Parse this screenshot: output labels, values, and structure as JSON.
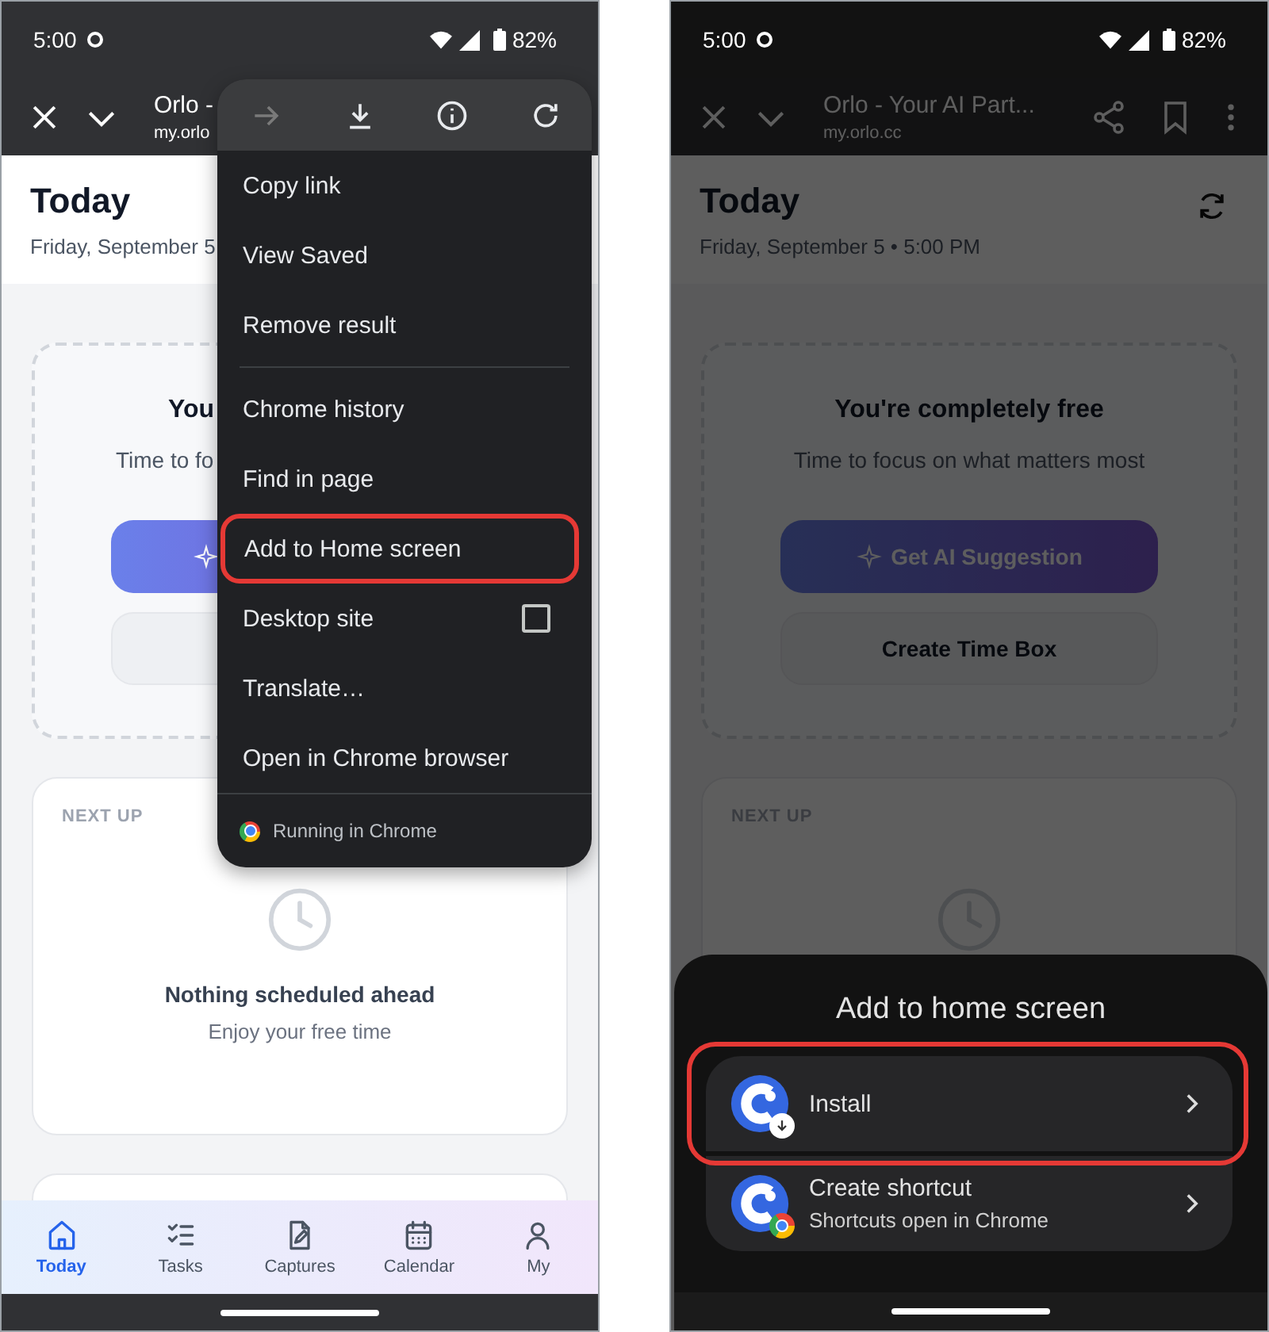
{
  "phones": [
    {
      "dimmed": false,
      "status": {
        "time": "5:00",
        "battery": "82%"
      },
      "browser": {
        "title": "Orlo -",
        "url": "my.orlo"
      },
      "header": {
        "title": "Today",
        "subtitle": "Friday, September 5"
      },
      "free_card": {
        "title": "You",
        "text": "Time to fo"
      },
      "next_up": {
        "label": "NEXT UP",
        "empty_title": "Nothing scheduled ahead",
        "empty_text": "Enjoy your free time"
      },
      "nav": [
        {
          "label": "Today",
          "selected": true
        },
        {
          "label": "Tasks",
          "selected": false
        },
        {
          "label": "Captures",
          "selected": false
        },
        {
          "label": "Calendar",
          "selected": false
        },
        {
          "label": "My",
          "selected": false
        }
      ],
      "menu": {
        "top_icons": [
          {
            "disabled": true
          },
          {
            "disabled": false
          },
          {
            "disabled": false
          },
          {
            "disabled": false
          }
        ],
        "sections": [
          [
            {
              "label": "Copy link",
              "kind": "action",
              "highlighted": false
            },
            {
              "label": "View Saved",
              "kind": "action",
              "highlighted": false
            },
            {
              "label": "Remove result",
              "kind": "action",
              "highlighted": false
            }
          ],
          [
            {
              "label": "Chrome history",
              "kind": "action",
              "highlighted": false
            },
            {
              "label": "Find in page",
              "kind": "action",
              "highlighted": false
            },
            {
              "label": "Add to Home screen",
              "kind": "action",
              "highlighted": true
            },
            {
              "label": "Desktop site",
              "kind": "checkbox",
              "checked": false,
              "highlighted": false
            },
            {
              "label": "Translate…",
              "kind": "action",
              "highlighted": false
            },
            {
              "label": "Open in Chrome browser",
              "kind": "action",
              "highlighted": false
            }
          ]
        ],
        "footer": "Running in Chrome"
      }
    },
    {
      "dimmed": true,
      "status": {
        "time": "5:00",
        "battery": "82%"
      },
      "browser": {
        "title": "Orlo - Your AI Part...",
        "url": "my.orlo.cc"
      },
      "header": {
        "title": "Today",
        "subtitle": "Friday, September 5 • 5:00 PM"
      },
      "free_card": {
        "title": "You're completely free",
        "text": "Time to focus on what matters most",
        "primary_button": "Get AI Suggestion",
        "secondary_button": "Create Time Box"
      },
      "next_up": {
        "label": "NEXT UP"
      },
      "sheet": {
        "title": "Add to home screen",
        "options": [
          {
            "label": "Install",
            "kind": "install",
            "highlighted": true
          },
          {
            "label": "Create shortcut",
            "subtitle": "Shortcuts open in Chrome",
            "kind": "shortcut",
            "highlighted": false
          }
        ]
      }
    }
  ]
}
